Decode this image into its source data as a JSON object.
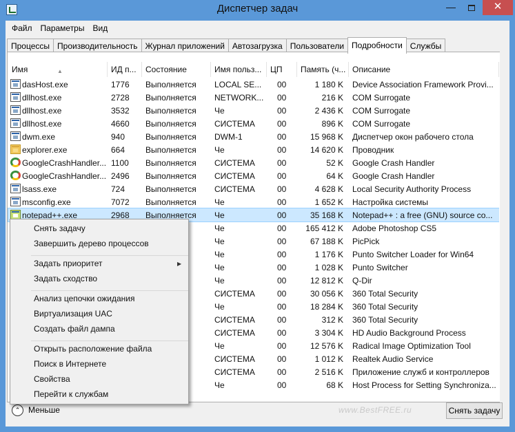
{
  "window": {
    "title": "Диспетчер задач",
    "minimize": "—",
    "close": "✕"
  },
  "menubar": [
    "Файл",
    "Параметры",
    "Вид"
  ],
  "tabs": [
    "Процессы",
    "Производительность",
    "Журнал приложений",
    "Автозагрузка",
    "Пользователи",
    "Подробности",
    "Службы"
  ],
  "active_tab": "Подробности",
  "columns": {
    "name": "Имя",
    "pid": "ИД п...",
    "state": "Состояние",
    "user": "Имя польз...",
    "cpu": "ЦП",
    "mem": "Память (ч...",
    "desc": "Описание"
  },
  "rows": [
    {
      "icon": "app",
      "name": "dasHost.exe",
      "pid": "1776",
      "state": "Выполняется",
      "user": "LOCAL SE...",
      "cpu": "00",
      "mem": "1 180 K",
      "desc": "Device Association Framework Provi..."
    },
    {
      "icon": "app",
      "name": "dllhost.exe",
      "pid": "2728",
      "state": "Выполняется",
      "user": "NETWORK...",
      "cpu": "00",
      "mem": "216 K",
      "desc": "COM Surrogate"
    },
    {
      "icon": "app",
      "name": "dllhost.exe",
      "pid": "3532",
      "state": "Выполняется",
      "user": "Че",
      "cpu": "00",
      "mem": "2 436 K",
      "desc": "COM Surrogate"
    },
    {
      "icon": "app",
      "name": "dllhost.exe",
      "pid": "4660",
      "state": "Выполняется",
      "user": "СИСТЕМА",
      "cpu": "00",
      "mem": "896 K",
      "desc": "COM Surrogate"
    },
    {
      "icon": "app",
      "name": "dwm.exe",
      "pid": "940",
      "state": "Выполняется",
      "user": "DWM-1",
      "cpu": "00",
      "mem": "15 968 K",
      "desc": "Диспетчер окон рабочего стола"
    },
    {
      "icon": "folder",
      "name": "explorer.exe",
      "pid": "664",
      "state": "Выполняется",
      "user": "Че",
      "cpu": "00",
      "mem": "14 620 K",
      "desc": "Проводник"
    },
    {
      "icon": "google",
      "name": "GoogleCrashHandler...",
      "pid": "1100",
      "state": "Выполняется",
      "user": "СИСТЕМА",
      "cpu": "00",
      "mem": "52 K",
      "desc": "Google Crash Handler"
    },
    {
      "icon": "google",
      "name": "GoogleCrashHandler...",
      "pid": "2496",
      "state": "Выполняется",
      "user": "СИСТЕМА",
      "cpu": "00",
      "mem": "64 K",
      "desc": "Google Crash Handler"
    },
    {
      "icon": "app",
      "name": "lsass.exe",
      "pid": "724",
      "state": "Выполняется",
      "user": "СИСТЕМА",
      "cpu": "00",
      "mem": "4 628 K",
      "desc": "Local Security Authority Process"
    },
    {
      "icon": "app",
      "name": "msconfig.exe",
      "pid": "7072",
      "state": "Выполняется",
      "user": "Че",
      "cpu": "00",
      "mem": "1 652 K",
      "desc": "Настройка системы"
    },
    {
      "icon": "notepad",
      "name": "notepad++.exe",
      "pid": "2968",
      "state": "Выполняется",
      "user": "Че",
      "cpu": "00",
      "mem": "35 168 K",
      "desc": "Notepad++ : a free (GNU) source co...",
      "selected": true
    },
    {
      "icon": "app",
      "name": "",
      "pid": "",
      "state": "ется",
      "user": "Че",
      "cpu": "00",
      "mem": "165 412 K",
      "desc": "Adobe Photoshop CS5"
    },
    {
      "icon": "app",
      "name": "",
      "pid": "",
      "state": "ется",
      "user": "Че",
      "cpu": "00",
      "mem": "67 188 K",
      "desc": "PicPick"
    },
    {
      "icon": "app",
      "name": "",
      "pid": "",
      "state": "ется",
      "user": "Че",
      "cpu": "00",
      "mem": "1 176 K",
      "desc": "Punto Switcher Loader for Win64"
    },
    {
      "icon": "app",
      "name": "",
      "pid": "",
      "state": "ется",
      "user": "Че",
      "cpu": "00",
      "mem": "1 028 K",
      "desc": "Punto Switcher"
    },
    {
      "icon": "app",
      "name": "",
      "pid": "",
      "state": "ется",
      "user": "Че",
      "cpu": "00",
      "mem": "12 812 K",
      "desc": "Q-Dir"
    },
    {
      "icon": "app",
      "name": "",
      "pid": "",
      "state": "ется",
      "user": "СИСТЕМА",
      "cpu": "00",
      "mem": "30 056 K",
      "desc": "360 Total Security"
    },
    {
      "icon": "app",
      "name": "",
      "pid": "",
      "state": "ется",
      "user": "Че",
      "cpu": "00",
      "mem": "18 284 K",
      "desc": "360 Total Security"
    },
    {
      "icon": "app",
      "name": "",
      "pid": "",
      "state": "ется",
      "user": "СИСТЕМА",
      "cpu": "00",
      "mem": "312 K",
      "desc": "360 Total Security"
    },
    {
      "icon": "app",
      "name": "",
      "pid": "",
      "state": "ется",
      "user": "СИСТЕМА",
      "cpu": "00",
      "mem": "3 304 K",
      "desc": "HD Audio Background Process"
    },
    {
      "icon": "app",
      "name": "",
      "pid": "",
      "state": "ется",
      "user": "Че",
      "cpu": "00",
      "mem": "12 576 K",
      "desc": "Radical Image Optimization Tool"
    },
    {
      "icon": "app",
      "name": "",
      "pid": "",
      "state": "ется",
      "user": "СИСТЕМА",
      "cpu": "00",
      "mem": "1 012 K",
      "desc": "Realtek Audio Service"
    },
    {
      "icon": "app",
      "name": "",
      "pid": "",
      "state": "ется",
      "user": "СИСТЕМА",
      "cpu": "00",
      "mem": "2 516 K",
      "desc": "Приложение служб и контроллеров"
    },
    {
      "icon": "app",
      "name": "",
      "pid": "",
      "state": "ется",
      "user": "Че",
      "cpu": "00",
      "mem": "68 K",
      "desc": "Host Process for Setting Synchroniza..."
    }
  ],
  "context_menu": [
    {
      "label": "Снять задачу"
    },
    {
      "label": "Завершить дерево процессов"
    },
    {
      "separator": true
    },
    {
      "label": "Задать приоритет",
      "submenu": true
    },
    {
      "label": "Задать сходство"
    },
    {
      "separator": true
    },
    {
      "label": "Анализ цепочки ожидания"
    },
    {
      "label": "Виртуализация UAC"
    },
    {
      "label": "Создать файл дампа"
    },
    {
      "separator": true
    },
    {
      "label": "Открыть расположение файла"
    },
    {
      "label": "Поиск в Интернете"
    },
    {
      "label": "Свойства"
    },
    {
      "label": "Перейти к службам"
    }
  ],
  "bottom": {
    "fewer_details": "Меньше",
    "end_task": "Снять задачу",
    "watermark": "www.BestFREE.ru"
  },
  "colors": {
    "title_bar": "#5a98d8",
    "close_button": "#c74f50",
    "selection": "#cce8ff"
  }
}
